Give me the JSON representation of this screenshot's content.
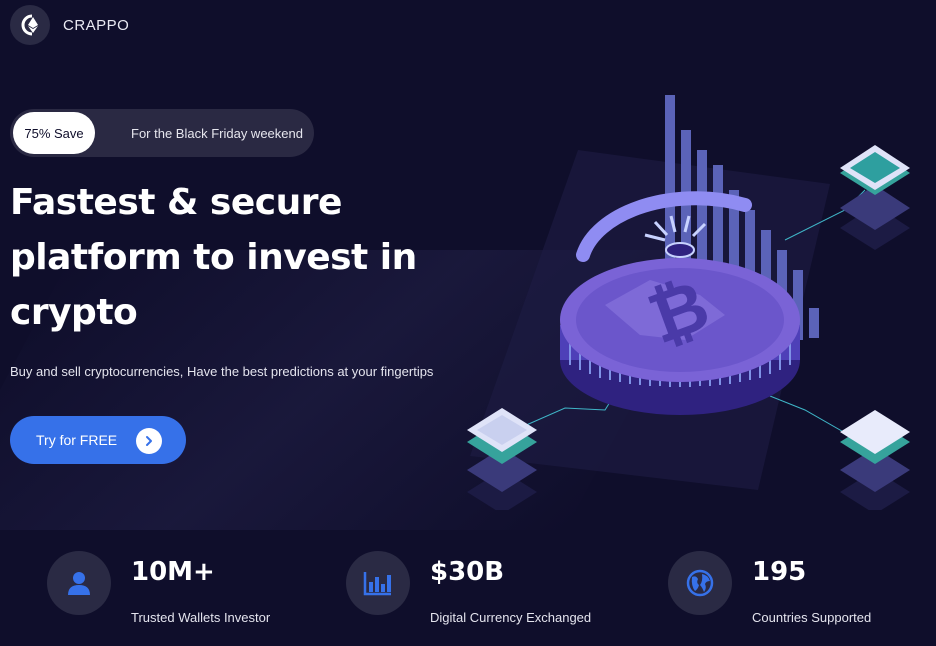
{
  "brand": {
    "name": "CRAPPO",
    "logo_icon": "ethereum-icon"
  },
  "promo": {
    "badge": "75% Save",
    "text": "For the Black Friday weekend"
  },
  "hero": {
    "headline": "Fastest & secure platform to invest in crypto",
    "subtitle": "Buy and sell cryptocurrencies, Have the best predictions at your fingertips",
    "cta_label": "Try for FREE",
    "cta_icon": "chevron-right-icon",
    "illustration": "bitcoin-coin-illustration"
  },
  "stats": [
    {
      "value": "10M+",
      "label": "Trusted Wallets Investor",
      "icon": "user-icon"
    },
    {
      "value": "$30B",
      "label": "Digital Currency Exchanged",
      "icon": "bar-chart-icon"
    },
    {
      "value": "195",
      "label": "Countries Supported",
      "icon": "globe-icon"
    }
  ],
  "colors": {
    "background": "#0f0e2b",
    "accent": "#3671e9",
    "surface": "#2a2a44",
    "coin": "#7a63d6"
  }
}
